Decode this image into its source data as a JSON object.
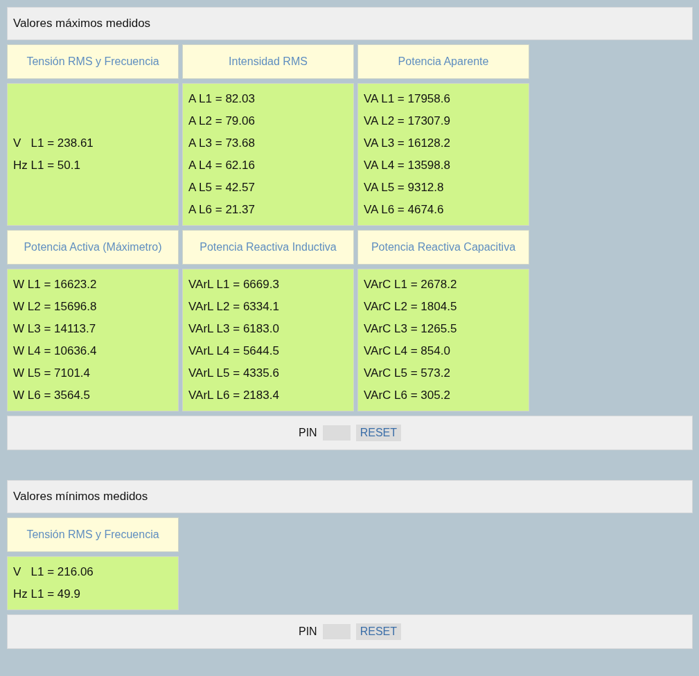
{
  "sections": [
    {
      "title": "Valores máximos medidos",
      "rows": [
        {
          "kind": "header",
          "cells": [
            "Tensión RMS y Frecuencia",
            "Intensidad RMS",
            "Potencia Aparente"
          ]
        },
        {
          "kind": "values",
          "cells": [
            [
              "V   L1 = 238.61",
              "Hz L1 = 50.1"
            ],
            [
              "A L1 = 82.03",
              "A L2 = 79.06",
              "A L3 = 73.68",
              "A L4 = 62.16",
              "A L5 = 42.57",
              "A L6 = 21.37"
            ],
            [
              "VA L1 = 17958.6",
              "VA L2 = 17307.9",
              "VA L3 = 16128.2",
              "VA L4 = 13598.8",
              "VA L5 = 9312.8",
              "VA L6 = 4674.6"
            ]
          ]
        },
        {
          "kind": "header",
          "cells": [
            "Potencia Activa (Máximetro)",
            "Potencia Reactiva Inductiva",
            "Potencia Reactiva Capacitiva"
          ]
        },
        {
          "kind": "values",
          "cells": [
            [
              "W L1 = 16623.2",
              "W L2 = 15696.8",
              "W L3 = 14113.7",
              "W L4 = 10636.4",
              "W L5 = 7101.4",
              "W L6 = 3564.5"
            ],
            [
              "VArL L1 = 6669.3",
              "VArL L2 = 6334.1",
              "VArL L3 = 6183.0",
              "VArL L4 = 5644.5",
              "VArL L5 = 4335.6",
              "VArL L6 = 2183.4"
            ],
            [
              "VArC L1 = 2678.2",
              "VArC L2 = 1804.5",
              "VArC L3 = 1265.5",
              "VArC L4 = 854.0",
              "VArC L5 = 573.2",
              "VArC L6 = 305.2"
            ]
          ]
        }
      ],
      "pin": {
        "label": "PIN",
        "button": "RESET"
      }
    },
    {
      "title": "Valores mínimos medidos",
      "rows": [
        {
          "kind": "header",
          "cells": [
            "Tensión RMS y Frecuencia"
          ]
        },
        {
          "kind": "values",
          "cells": [
            [
              "V   L1 = 216.06",
              "Hz L1 = 49.9"
            ]
          ]
        }
      ],
      "pin": {
        "label": "PIN",
        "button": "RESET"
      }
    }
  ]
}
